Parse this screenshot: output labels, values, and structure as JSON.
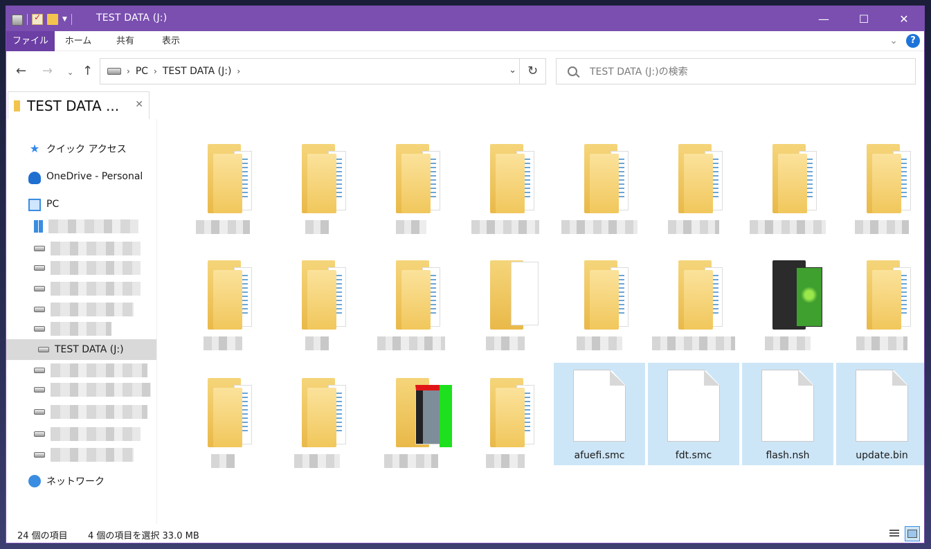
{
  "window": {
    "title": "TEST DATA (J:)",
    "accent": "#7a4fb0"
  },
  "ribbon": {
    "tabs": [
      "ファイル",
      "ホーム",
      "共有",
      "表示"
    ],
    "help_label": "?"
  },
  "address": {
    "crumbs": [
      "PC",
      "TEST DATA (J:)"
    ],
    "search_placeholder": "TEST DATA (J:)の検索"
  },
  "doc_tab": {
    "label": "TEST DATA ..."
  },
  "sidebar": {
    "quick_access": "クイック アクセス",
    "onedrive": "OneDrive - Personal",
    "pc": "PC",
    "current_drive": "TEST DATA (J:)",
    "network": "ネットワーク"
  },
  "files": [
    {
      "name": "afuefi.smc"
    },
    {
      "name": "fdt.smc"
    },
    {
      "name": "flash.nsh"
    },
    {
      "name": "update.bin"
    }
  ],
  "status": {
    "item_count": "24 個の項目",
    "selection": "4 個の項目を選択  33.0 MB"
  }
}
